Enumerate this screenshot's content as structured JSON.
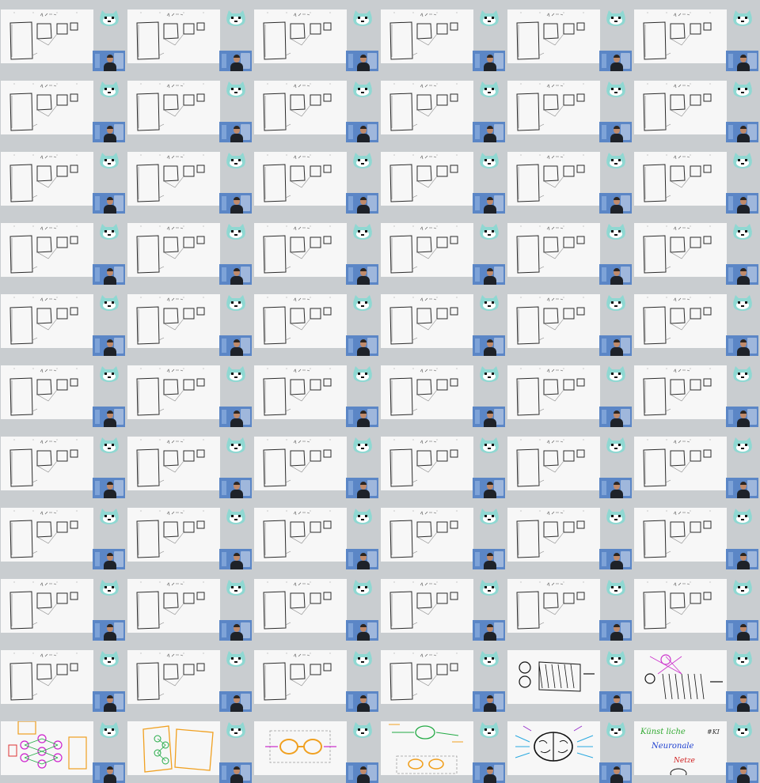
{
  "screen": {
    "background": "#c9cdd0"
  },
  "grid": {
    "columns": 6,
    "rows": 11
  },
  "colors": {
    "whiteboard": "#f7f7f7",
    "ink": "#2b2b2b",
    "mascot": "#8fd8d2",
    "camera_bg": "#5b86c6"
  },
  "icons": {
    "mascot": "mascot-face-icon",
    "webcam": "webcam-presenter-thumbnail"
  },
  "tiles_special": {
    "r9c4": {
      "drawing": "grid-of-shapes",
      "colors": [
        "#111111"
      ]
    },
    "r9c5": {
      "drawing": "shapes-colored",
      "colors": [
        "#111111",
        "#cc33cc",
        "#33aa33"
      ]
    },
    "r10c0": {
      "drawing": "neural-network-colored",
      "colors": [
        "#f0a020",
        "#cc22cc",
        "#22aa44",
        "#dd3333"
      ]
    },
    "r10c1": {
      "drawing": "neural-network-orange",
      "colors": [
        "#f0a020",
        "#22aa44"
      ]
    },
    "r10c2": {
      "drawing": "neuron-rings",
      "colors": [
        "#f0a020",
        "#22aa44",
        "#cc33cc"
      ]
    },
    "r10c3": {
      "drawing": "single-neuron",
      "colors": [
        "#f0a020",
        "#22aa44",
        "#cc33cc"
      ]
    },
    "r10c4": {
      "drawing": "brain",
      "colors": [
        "#111111",
        "#2aa9e0",
        "#9933cc"
      ]
    },
    "r10c5": {
      "drawing": "title-text",
      "colors": [
        "#33aa33",
        "#1e40d0",
        "#d02020",
        "#333333"
      ]
    }
  },
  "title_tile": {
    "line1": "Künst liche",
    "line2": "Neuronale",
    "line3": "Netze",
    "tag": "#KI"
  }
}
